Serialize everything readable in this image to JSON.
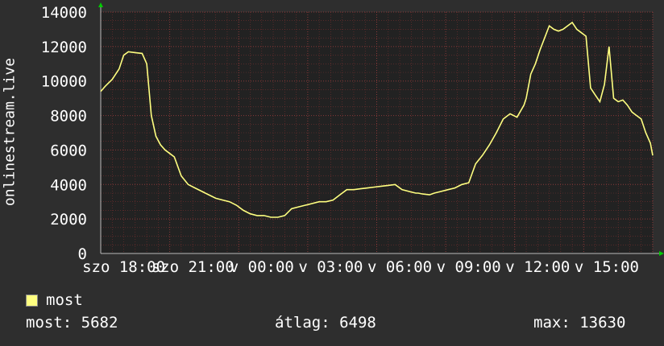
{
  "chart_data": {
    "type": "line",
    "ylabel": "onlinestream.live",
    "ylim": [
      0,
      14000
    ],
    "yticks": [
      0,
      2000,
      4000,
      6000,
      8000,
      10000,
      12000,
      14000
    ],
    "xticks": [
      "szo 18:00",
      "szo 21:00",
      "v 00:00",
      "v 03:00",
      "v 06:00",
      "v 09:00",
      "v 12:00",
      "v 15:00"
    ],
    "grid": true,
    "colors": {
      "background": "#2e2e2e",
      "plot": "#222222",
      "line": "#ffff80",
      "grid": "#7a3030",
      "axis_arrow": "#00cc00"
    },
    "series": [
      {
        "name": "most",
        "x": [
          0,
          0.2,
          0.5,
          0.8,
          1.0,
          1.2,
          1.5,
          1.8,
          2.0,
          2.2,
          2.4,
          2.6,
          2.8,
          3.0,
          3.2,
          3.5,
          3.8,
          4.1,
          4.4,
          4.7,
          5.0,
          5.3,
          5.6,
          5.9,
          6.2,
          6.5,
          6.8,
          7.1,
          7.4,
          7.7,
          8.0,
          8.3,
          8.6,
          8.9,
          9.2,
          9.5,
          9.8,
          10.1,
          10.4,
          10.7,
          11.0,
          11.3,
          11.6,
          11.9,
          12.2,
          12.5,
          12.8,
          13.1,
          13.4,
          13.7,
          13.8,
          14.0,
          14.3,
          14.5,
          14.8,
          15.1,
          15.4,
          15.7,
          16.0,
          16.3,
          16.6,
          16.9,
          17.2,
          17.5,
          17.8,
          18.1,
          18.4,
          18.5,
          18.7,
          18.9,
          19.1,
          19.3,
          19.5,
          19.7,
          19.9,
          20.1,
          20.3,
          20.5,
          20.7,
          20.9,
          21.1,
          21.3,
          21.5,
          21.7,
          21.9,
          22.1,
          22.3,
          22.5,
          22.7,
          22.9,
          23.1,
          23.3,
          23.5,
          23.7,
          23.9,
          24.0
        ],
        "values": [
          9400,
          9700,
          10100,
          10700,
          11500,
          11700,
          11650,
          11600,
          11000,
          8000,
          6800,
          6300,
          6000,
          5800,
          5600,
          4500,
          4000,
          3800,
          3600,
          3400,
          3200,
          3100,
          3000,
          2800,
          2500,
          2300,
          2200,
          2200,
          2100,
          2100,
          2200,
          2600,
          2700,
          2800,
          2900,
          3000,
          3000,
          3100,
          3400,
          3700,
          3700,
          3750,
          3800,
          3850,
          3900,
          3950,
          4000,
          3700,
          3600,
          3500,
          3500,
          3450,
          3400,
          3500,
          3600,
          3700,
          3800,
          4000,
          4100,
          5200,
          5700,
          6300,
          7000,
          7800,
          8100,
          7900,
          8600,
          9000,
          10400,
          11000,
          11800,
          12500,
          13200,
          13000,
          12900,
          13000,
          13200,
          13400,
          13000,
          12800,
          12600,
          9600,
          9200,
          8800,
          9800,
          12000,
          9000,
          8800,
          8900,
          8600,
          8200,
          8000,
          7800,
          7000,
          6400,
          5682
        ]
      }
    ]
  },
  "legend": {
    "label": "most"
  },
  "stats": {
    "now_label": "most:",
    "now_value": "5682",
    "avg_label": "átlag:",
    "avg_value": "6498",
    "max_label": "max:",
    "max_value": "13630"
  }
}
